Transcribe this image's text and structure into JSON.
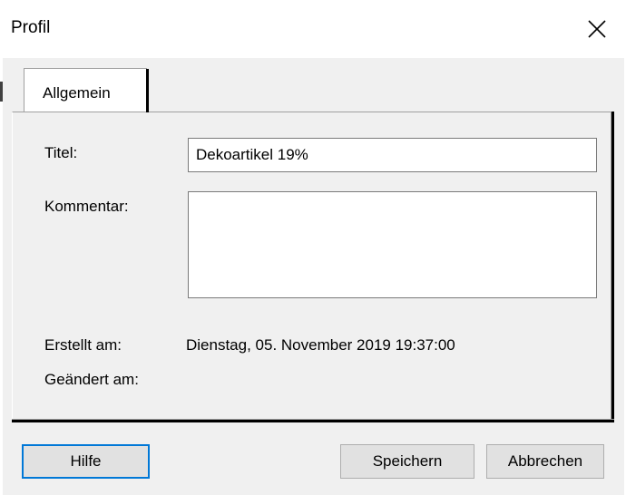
{
  "window": {
    "title": "Profil",
    "close_icon": "close-icon"
  },
  "tabs": [
    {
      "label": "Allgemein",
      "selected": true
    }
  ],
  "form": {
    "titel_label": "Titel:",
    "titel_value": "Dekoartikel 19%",
    "kommentar_label": "Kommentar:",
    "kommentar_value": "",
    "erstellt_label": "Erstellt am:",
    "erstellt_value": "Dienstag, 05. November 2019 19:37:00",
    "geaendert_label": "Geändert am:",
    "geaendert_value": ""
  },
  "buttons": {
    "help": "Hilfe",
    "save": "Speichern",
    "cancel": "Abbrechen"
  },
  "colors": {
    "focus_border": "#0078d7",
    "dialog_bg": "#f0f0f0"
  }
}
